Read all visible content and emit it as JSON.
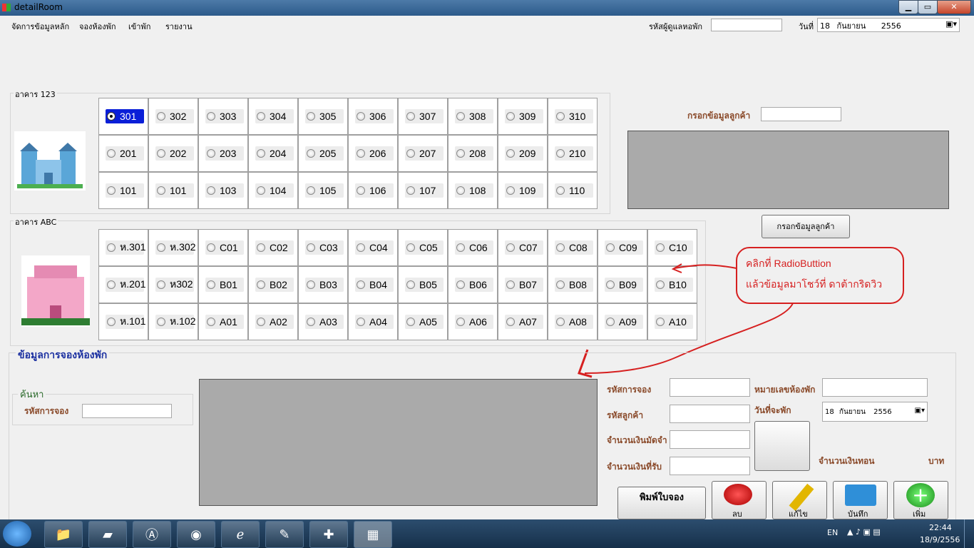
{
  "window": {
    "title": "detailRoom",
    "minimize": "▁",
    "maximize": "▭",
    "close": "✕"
  },
  "menu": {
    "items": [
      "จัดการข้อมูลหลัก",
      "จองห้องพัก",
      "เข้าพัก",
      "รายงาน"
    ],
    "staff_label": "รหัสผู้ดูแลหอพัก",
    "staff_value": "",
    "date_label": "วันที่",
    "date_day": "18",
    "date_month": "กันยายน",
    "date_year": "2556"
  },
  "building1": {
    "title": "อาคาร 123",
    "rows": [
      [
        "301",
        "302",
        "303",
        "304",
        "305",
        "306",
        "307",
        "308",
        "309",
        "310"
      ],
      [
        "201",
        "202",
        "203",
        "204",
        "205",
        "206",
        "207",
        "208",
        "209",
        "210"
      ],
      [
        "101",
        "101",
        "103",
        "104",
        "105",
        "106",
        "107",
        "108",
        "109",
        "110"
      ]
    ],
    "selected": "301"
  },
  "building2": {
    "title": "อาคาร ABC",
    "rows": [
      [
        "ห.301",
        "ห.302",
        "C01",
        "C02",
        "C03",
        "C04",
        "C05",
        "C06",
        "C07",
        "C08",
        "C09",
        "C10"
      ],
      [
        "ห.201",
        "ห302",
        "B01",
        "B02",
        "B03",
        "B04",
        "B05",
        "B06",
        "B07",
        "B08",
        "B09",
        "B10"
      ],
      [
        "ห.101",
        "ห.102",
        "A01",
        "A02",
        "A03",
        "A04",
        "A05",
        "A06",
        "A07",
        "A08",
        "A09",
        "A10"
      ]
    ]
  },
  "customer": {
    "label": "กรอกข้อมูลลูกค้า",
    "value": "",
    "button": "กรอกข้อมูลลูกค้า"
  },
  "annotation": {
    "line1": "คลิกที่ RadioButtion",
    "line2": "แล้วข้อมูลมาโชว์ที่   ดาต้ากริดวิว"
  },
  "booking": {
    "title": "ข้อมูลการจองห้องพัก",
    "search_title": "ค้นหา",
    "search_label": "รหัสการจอง",
    "search_value": "",
    "booking_id_label": "รหัสการจอง",
    "customer_id_label": "รหัสลูกค้า",
    "deposit_label": "จำนวนเงินมัดจำ",
    "received_label": "จำนวนเงินที่รับ",
    "room_no_label": "หมายเลขห้องพัก",
    "checkin_label": "วันที่จะพัก",
    "checkin_day": "18",
    "checkin_month": "กันยายน",
    "checkin_year": "2556",
    "change_label": "จำนวนเงินทอน",
    "currency": "บาท",
    "print_button": "พิมพ์ใบจอง",
    "delete_button": "ลบ",
    "edit_button": "แก้ไข",
    "save_button": "บันทึก",
    "add_button": "เพิ่ม"
  },
  "taskbar": {
    "lang": "EN",
    "time": "22:44",
    "date": "18/9/2556"
  }
}
